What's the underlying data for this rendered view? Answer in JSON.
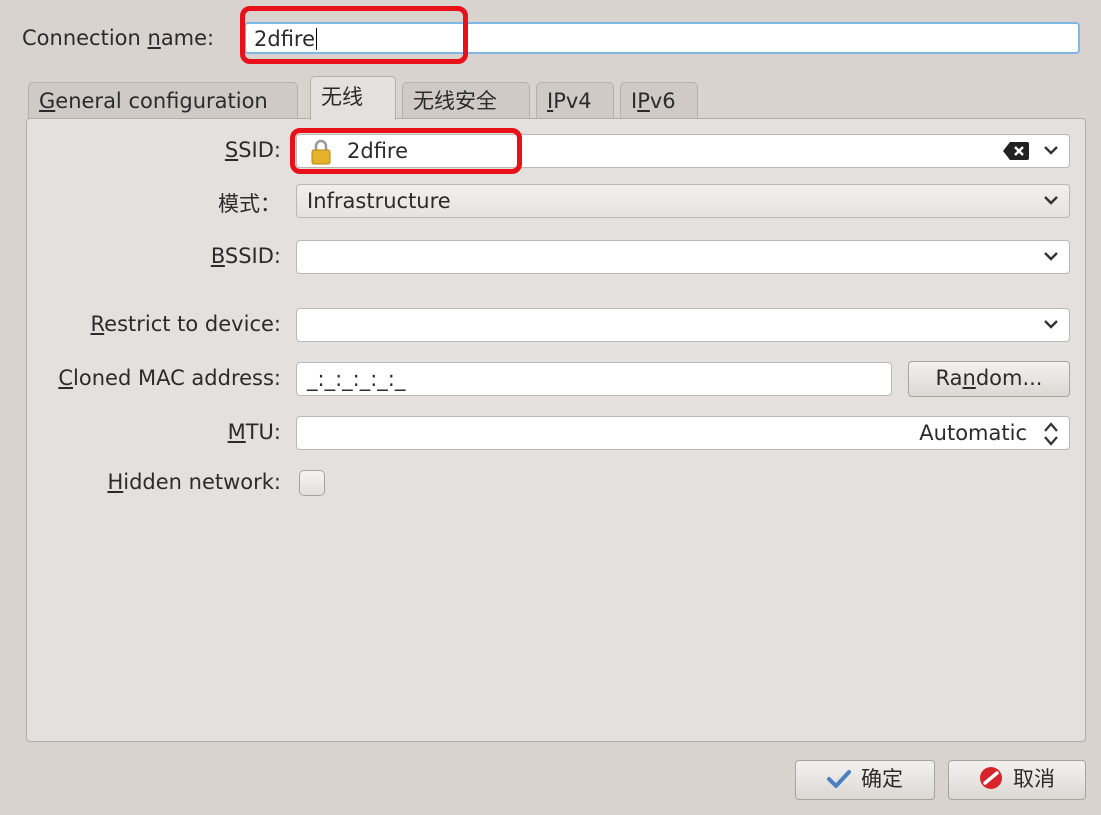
{
  "connection": {
    "label_pre": "Connection ",
    "label_u": "n",
    "label_post": "ame:",
    "value": "2dfire"
  },
  "tabs": [
    {
      "pre": "",
      "u": "G",
      "post": "eneral configuration",
      "active": false
    },
    {
      "pre": "",
      "u": "",
      "post": "无线",
      "active": true
    },
    {
      "pre": "",
      "u": "",
      "post": "无线安全",
      "active": false
    },
    {
      "pre": "",
      "u": "I",
      "post": "Pv4",
      "active": false
    },
    {
      "pre": "I",
      "u": "P",
      "post": "v6",
      "active": false
    }
  ],
  "ssid": {
    "label_u": "S",
    "label_post": "SID:",
    "value": "2dfire"
  },
  "mode": {
    "label": "模式：",
    "value": "Infrastructure"
  },
  "bssid": {
    "label_u": "B",
    "label_post": "SSID:",
    "value": ""
  },
  "restrict": {
    "label_u": "R",
    "label_post": "estrict to device:",
    "value": ""
  },
  "mac": {
    "label_u": "C",
    "label_post": "loned MAC address:",
    "value": "_:_:_:_:_:_",
    "random_pre": "Ra",
    "random_u": "n",
    "random_post": "dom..."
  },
  "mtu": {
    "label_u": "M",
    "label_post": "TU:",
    "value": "Automatic"
  },
  "hidden": {
    "label_u": "H",
    "label_post": "idden network:",
    "checked": false
  },
  "footer": {
    "ok_label": "确定",
    "cancel_label": "取消"
  },
  "colors": {
    "highlight": "#e8111a",
    "focus": "#7fb7e6",
    "ok_check": "#4a7fc0",
    "cancel_red": "#d8232a"
  }
}
